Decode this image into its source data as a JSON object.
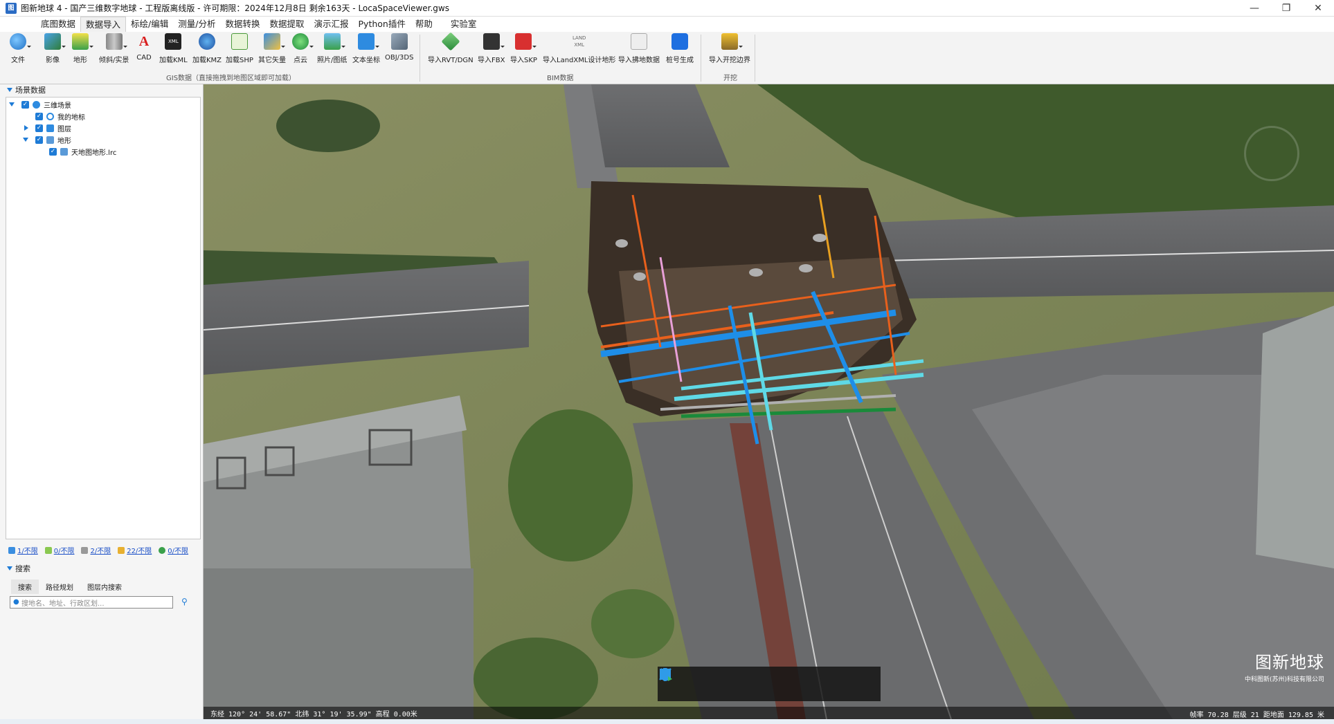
{
  "window": {
    "title": "图新地球 4 - 国产三维数字地球 - 工程版离线版 - 许可期限：2024年12月8日 剩余163天 - LocaSpaceViewer.gws",
    "app_icon": "globe-app-icon",
    "controls": [
      "minimize-icon",
      "restore-icon",
      "close-icon"
    ]
  },
  "menu": {
    "tabs": [
      "底图数据",
      "数据导入",
      "标绘/编辑",
      "测量/分析",
      "数据转换",
      "数据提取",
      "演示汇报",
      "Python插件",
      "帮助",
      "实验室"
    ],
    "active": "数据导入"
  },
  "ribbon": {
    "file_button": "文件",
    "gis_buttons": [
      "影像",
      "地形",
      "倾斜/实景",
      "CAD",
      "加载KML",
      "加载KMZ",
      "加载SHP",
      "其它矢量",
      "点云",
      "照片/图纸",
      "文本坐标",
      "OBJ/3DS"
    ],
    "gis_group_label": "GIS数据（直接拖拽到地图区域即可加载）",
    "bim_buttons": [
      "导入RVT/DGN",
      "导入FBX",
      "导入SKP",
      "导入LandXML设计地形",
      "导入拂地数据",
      "桩号生成"
    ],
    "bim_group_label": "BIM数据",
    "landxml_icon_text": "LAND XML",
    "kml_icon_text": "XML",
    "excavation_button": "导入开挖边界",
    "excavation_group_label": "开挖"
  },
  "left_panel": {
    "scene_header": "场景数据",
    "tree": [
      {
        "label": "三维场景",
        "level": 0,
        "icon": "globe-icon"
      },
      {
        "label": "我的地标",
        "level": 1,
        "icon": "pin-icon"
      },
      {
        "label": "图层",
        "level": 1,
        "icon": "layers-icon"
      },
      {
        "label": "地形",
        "level": 1,
        "icon": "terrain-icon"
      },
      {
        "label": "天地图地形.lrc",
        "level": 2,
        "icon": "terrain-file-icon"
      }
    ],
    "stats": [
      "1/不限",
      "0/不限",
      "2/不限",
      "22/不限",
      "0/不限"
    ],
    "search_header": "搜索",
    "search_tabs": [
      "搜索",
      "路径规划",
      "图层内搜索"
    ],
    "search_placeholder": "搜地名、地址、行政区划..."
  },
  "map": {
    "tools": [
      "hand-pan-icon",
      "pointer-select-icon",
      "location-pin-icon",
      "line-draw-icon",
      "polygon-draw-icon",
      "chart-analysis-icon"
    ],
    "watermark_title": "图新地球",
    "watermark_sub": "中科图新(苏州)科技有限公司",
    "status_left": "东经 120° 24' 58.67\"  北纬 31° 19' 35.99\"    高程 0.00米",
    "status_right": "帧率 70.28  层级 21  距地面 129.85 米"
  },
  "colors": {
    "accent": "#1e7bd6",
    "pipe_blue": "#1e8ee8",
    "pipe_cyan": "#5fd9e6",
    "pipe_orange": "#e8601c",
    "pipe_green": "#1a8a3a",
    "pipe_pink": "#e8a0d8"
  }
}
